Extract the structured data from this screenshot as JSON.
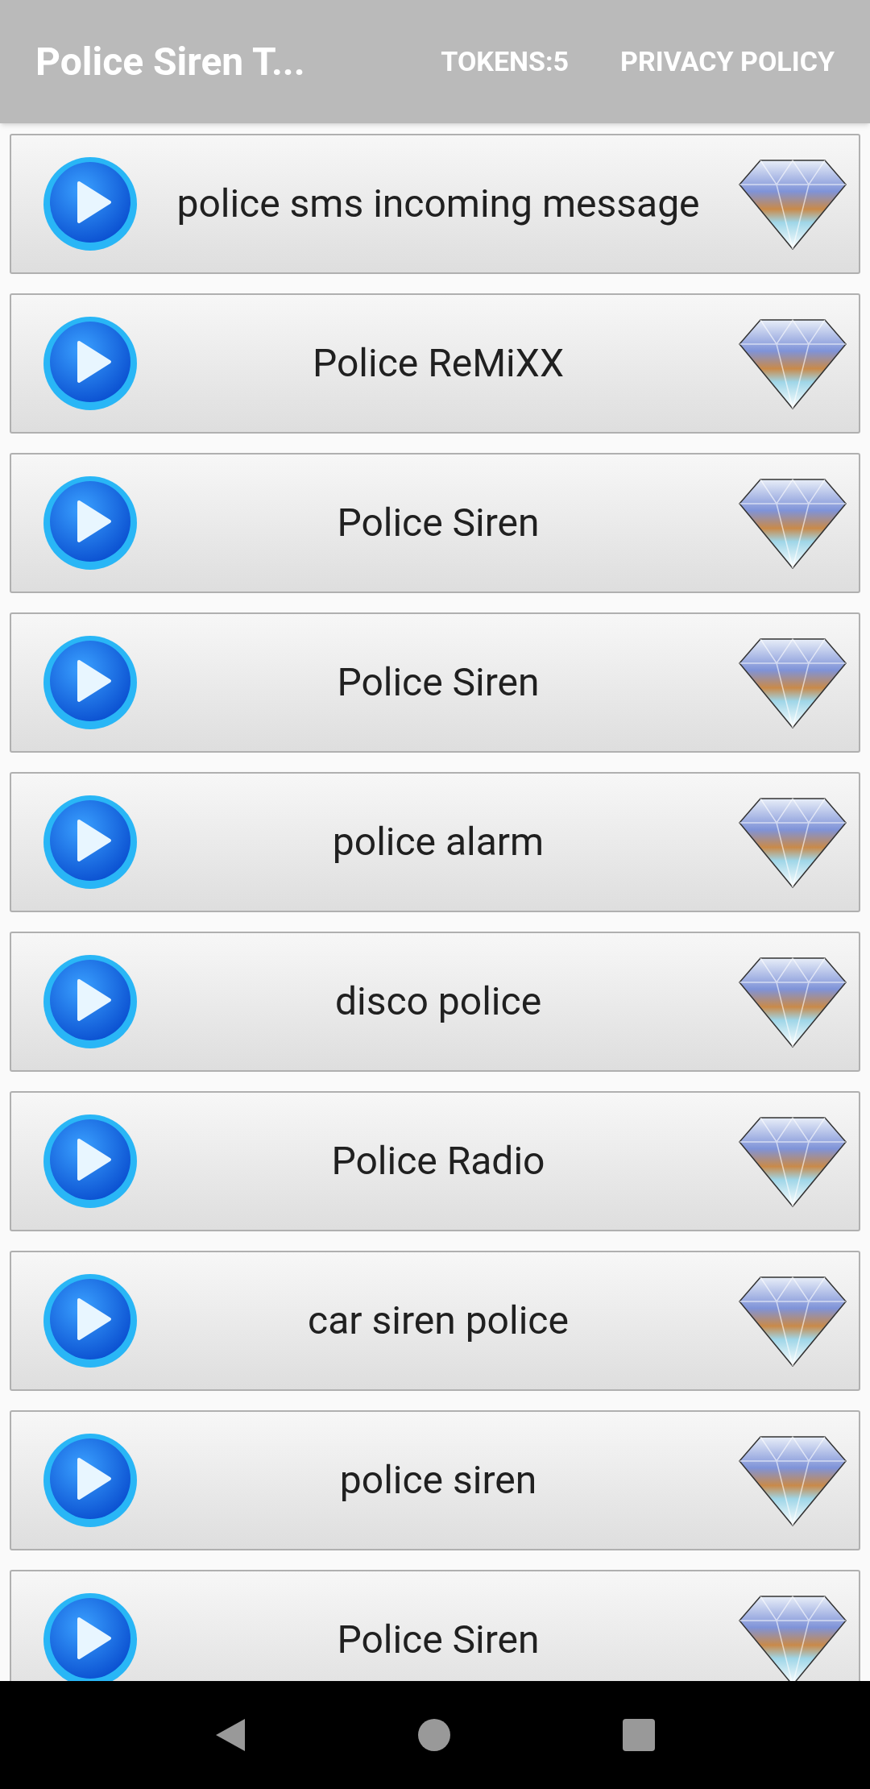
{
  "app_bar": {
    "title": "Police Siren T...",
    "actions": [
      "TOKENS:5",
      "PRIVACY POLICY"
    ]
  },
  "sounds": [
    {
      "name": "police sms incoming message"
    },
    {
      "name": "Police ReMiXX"
    },
    {
      "name": "Police Siren"
    },
    {
      "name": "Police Siren"
    },
    {
      "name": "police alarm"
    },
    {
      "name": "disco police"
    },
    {
      "name": "Police Radio"
    },
    {
      "name": "car siren police"
    },
    {
      "name": "police siren"
    },
    {
      "name": "Police Siren"
    }
  ]
}
